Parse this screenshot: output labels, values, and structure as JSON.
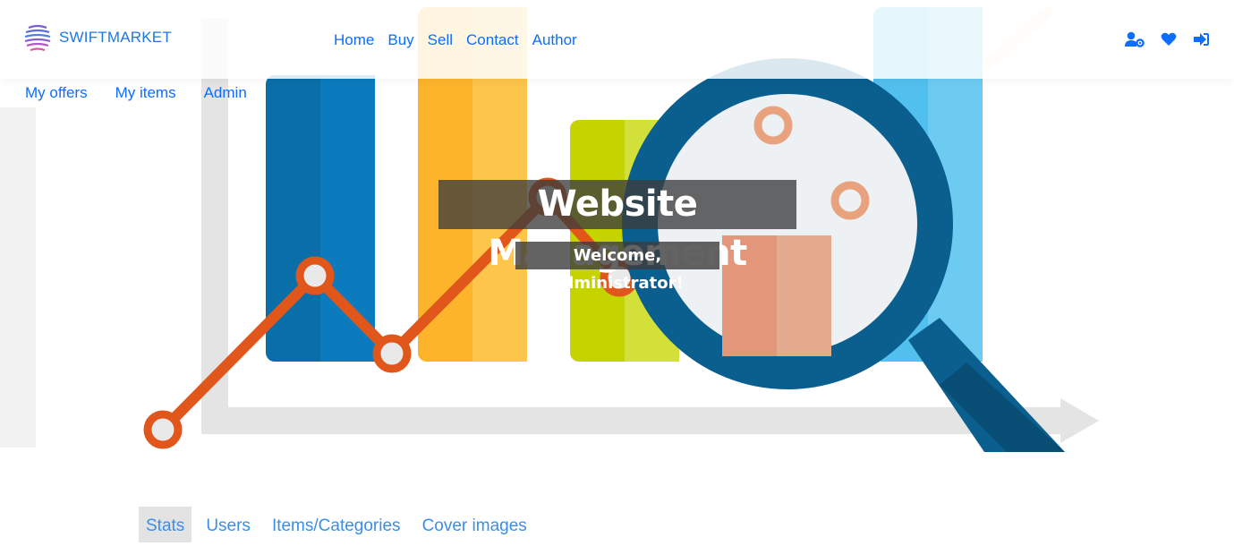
{
  "brand": {
    "name": "SWIFTMARKET",
    "logo_icon": "globe-stripes-icon",
    "color": "#1e78e6"
  },
  "nav": {
    "links": [
      "Home",
      "Buy",
      "Sell",
      "Contact",
      "Author"
    ],
    "icons": [
      "user-settings-icon",
      "heart-icon",
      "logout-icon"
    ],
    "link_color": "#0d6efd"
  },
  "subnav": {
    "links": [
      "My offers",
      "My items",
      "Admin"
    ]
  },
  "hero": {
    "title": "Website Management",
    "subtitle": "Welcome, administrator!"
  },
  "tabs": {
    "items": [
      "Stats",
      "Users",
      "Items/Categories",
      "Cover images"
    ],
    "active": "Stats"
  }
}
